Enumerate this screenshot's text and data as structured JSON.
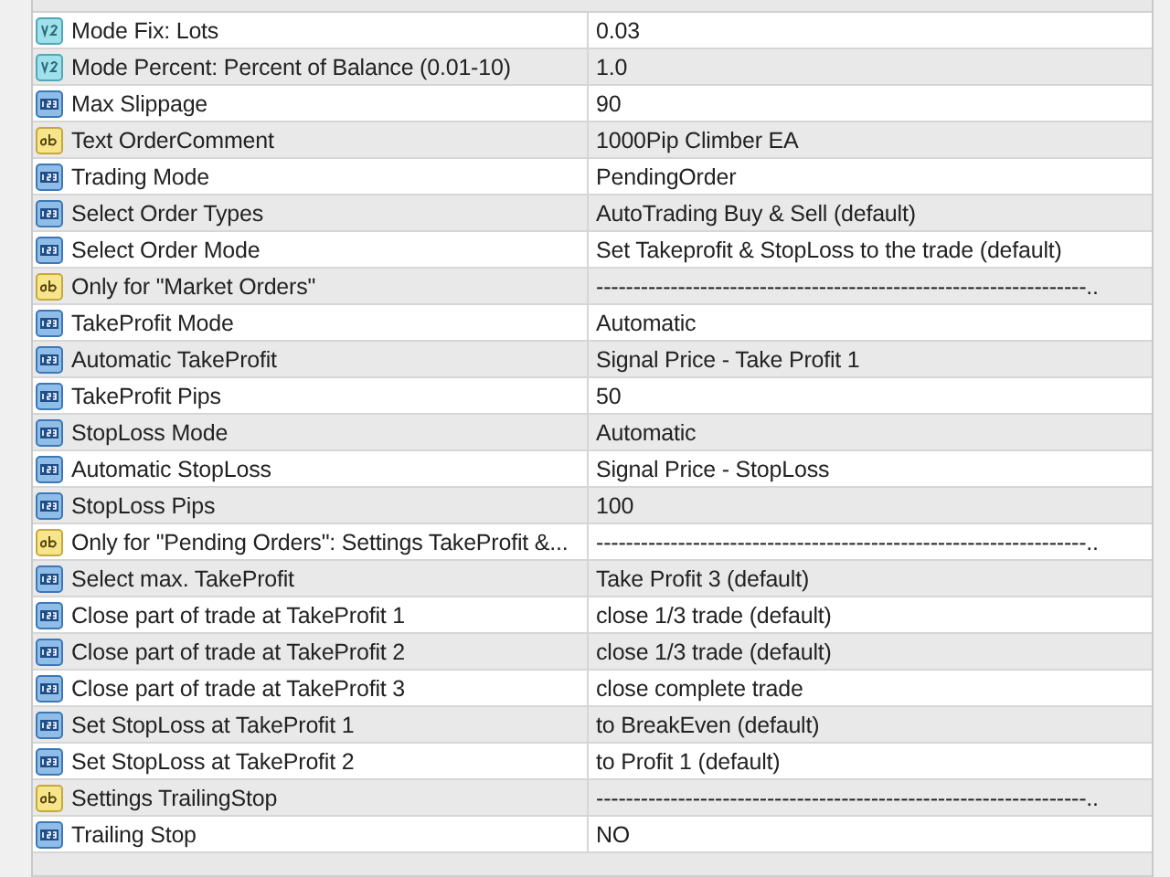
{
  "inputs": [
    {
      "kind": "double",
      "name": "Mode Fix: Lots",
      "value": "0.03"
    },
    {
      "kind": "double",
      "name": "Mode Percent: Percent of Balance (0.01-10)",
      "value": "1.0"
    },
    {
      "kind": "int",
      "name": "Max Slippage",
      "value": "90"
    },
    {
      "kind": "string",
      "name": "Text OrderComment",
      "value": "1000Pip Climber EA"
    },
    {
      "kind": "int",
      "name": "Trading Mode",
      "value": "PendingOrder"
    },
    {
      "kind": "int",
      "name": "Select Order Types",
      "value": "AutoTrading Buy & Sell (default)"
    },
    {
      "kind": "int",
      "name": "Select Order Mode",
      "value": "Set Takeprofit & StopLoss to the trade (default)"
    },
    {
      "kind": "string",
      "name": "Only for \"Market Orders\"",
      "value": "------------------------------------------------------------------.."
    },
    {
      "kind": "int",
      "name": "TakeProfit Mode",
      "value": "Automatic"
    },
    {
      "kind": "int",
      "name": "Automatic TakeProfit",
      "value": "Signal Price - Take Profit 1"
    },
    {
      "kind": "int",
      "name": "TakeProfit Pips",
      "value": "50"
    },
    {
      "kind": "int",
      "name": "StopLoss Mode",
      "value": "Automatic"
    },
    {
      "kind": "int",
      "name": "Automatic StopLoss",
      "value": "Signal Price - StopLoss"
    },
    {
      "kind": "int",
      "name": "StopLoss Pips",
      "value": "100"
    },
    {
      "kind": "string",
      "name": "Only for \"Pending Orders\": Settings TakeProfit &...",
      "value": "------------------------------------------------------------------.."
    },
    {
      "kind": "int",
      "name": "Select max. TakeProfit",
      "value": "Take Profit 3 (default)"
    },
    {
      "kind": "int",
      "name": "Close part of trade at TakeProfit 1",
      "value": "close 1/3 trade (default)"
    },
    {
      "kind": "int",
      "name": "Close part of trade at TakeProfit 2",
      "value": "close 1/3 trade (default)"
    },
    {
      "kind": "int",
      "name": "Close part of trade at TakeProfit 3",
      "value": "close complete trade"
    },
    {
      "kind": "int",
      "name": "Set StopLoss at TakeProfit 1",
      "value": "to BreakEven (default)"
    },
    {
      "kind": "int",
      "name": "Set StopLoss at TakeProfit 2",
      "value": "to Profit 1 (default)"
    },
    {
      "kind": "string",
      "name": "Settings TrailingStop",
      "value": "------------------------------------------------------------------.."
    },
    {
      "kind": "int",
      "name": "Trailing Stop",
      "value": "NO"
    }
  ]
}
